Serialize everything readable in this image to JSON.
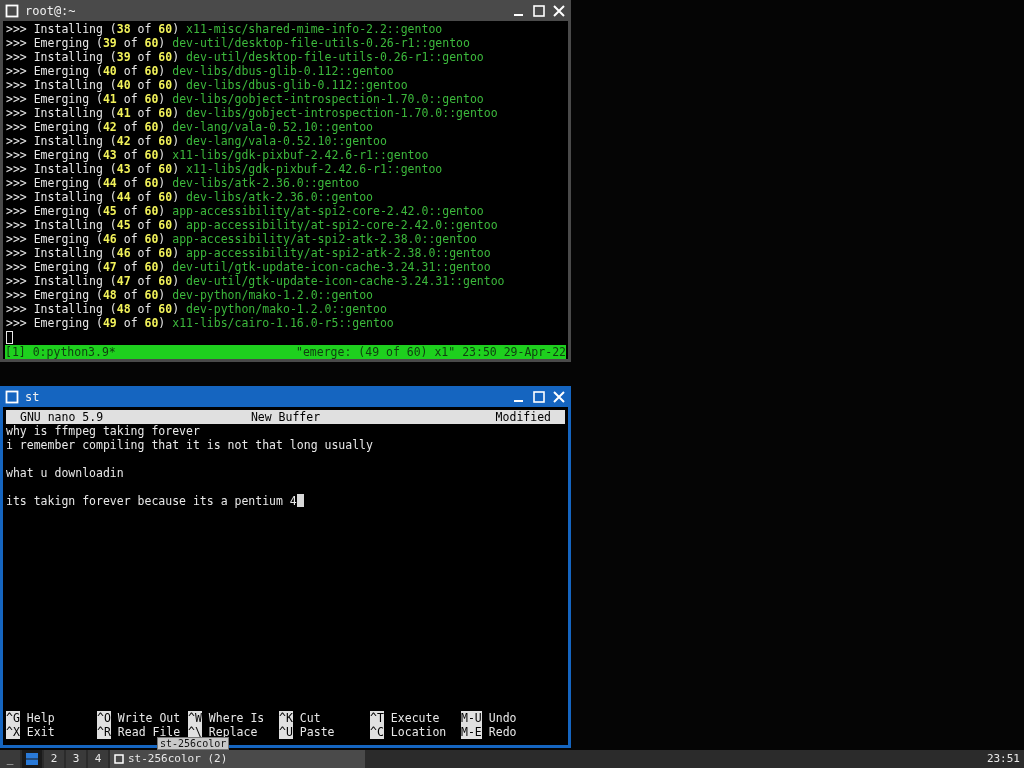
{
  "windows": [
    {
      "title": "root@:~",
      "focused": false,
      "kind": "tmux",
      "lines": [
        {
          "segments": [
            {
              "kind": "plain",
              "text": ">>> Installing ("
            },
            {
              "kind": "number",
              "text": "38"
            },
            {
              "kind": "plain",
              "text": " of "
            },
            {
              "kind": "number",
              "text": "60"
            },
            {
              "kind": "plain",
              "text": ") "
            },
            {
              "kind": "package",
              "text": "x11-misc/shared-mime-info-2.2::gentoo"
            }
          ]
        },
        {
          "segments": [
            {
              "kind": "plain",
              "text": ">>> Emerging ("
            },
            {
              "kind": "number",
              "text": "39"
            },
            {
              "kind": "plain",
              "text": " of "
            },
            {
              "kind": "number",
              "text": "60"
            },
            {
              "kind": "plain",
              "text": ") "
            },
            {
              "kind": "package",
              "text": "dev-util/desktop-file-utils-0.26-r1::gentoo"
            }
          ]
        },
        {
          "segments": [
            {
              "kind": "plain",
              "text": ">>> Installing ("
            },
            {
              "kind": "number",
              "text": "39"
            },
            {
              "kind": "plain",
              "text": " of "
            },
            {
              "kind": "number",
              "text": "60"
            },
            {
              "kind": "plain",
              "text": ") "
            },
            {
              "kind": "package",
              "text": "dev-util/desktop-file-utils-0.26-r1::gentoo"
            }
          ]
        },
        {
          "segments": [
            {
              "kind": "plain",
              "text": ">>> Emerging ("
            },
            {
              "kind": "number",
              "text": "40"
            },
            {
              "kind": "plain",
              "text": " of "
            },
            {
              "kind": "number",
              "text": "60"
            },
            {
              "kind": "plain",
              "text": ") "
            },
            {
              "kind": "package",
              "text": "dev-libs/dbus-glib-0.112::gentoo"
            }
          ]
        },
        {
          "segments": [
            {
              "kind": "plain",
              "text": ">>> Installing ("
            },
            {
              "kind": "number",
              "text": "40"
            },
            {
              "kind": "plain",
              "text": " of "
            },
            {
              "kind": "number",
              "text": "60"
            },
            {
              "kind": "plain",
              "text": ") "
            },
            {
              "kind": "package",
              "text": "dev-libs/dbus-glib-0.112::gentoo"
            }
          ]
        },
        {
          "segments": [
            {
              "kind": "plain",
              "text": ">>> Emerging ("
            },
            {
              "kind": "number",
              "text": "41"
            },
            {
              "kind": "plain",
              "text": " of "
            },
            {
              "kind": "number",
              "text": "60"
            },
            {
              "kind": "plain",
              "text": ") "
            },
            {
              "kind": "package",
              "text": "dev-libs/gobject-introspection-1.70.0::gentoo"
            }
          ]
        },
        {
          "segments": [
            {
              "kind": "plain",
              "text": ">>> Installing ("
            },
            {
              "kind": "number",
              "text": "41"
            },
            {
              "kind": "plain",
              "text": " of "
            },
            {
              "kind": "number",
              "text": "60"
            },
            {
              "kind": "plain",
              "text": ") "
            },
            {
              "kind": "package",
              "text": "dev-libs/gobject-introspection-1.70.0::gentoo"
            }
          ]
        },
        {
          "segments": [
            {
              "kind": "plain",
              "text": ">>> Emerging ("
            },
            {
              "kind": "number",
              "text": "42"
            },
            {
              "kind": "plain",
              "text": " of "
            },
            {
              "kind": "number",
              "text": "60"
            },
            {
              "kind": "plain",
              "text": ") "
            },
            {
              "kind": "package",
              "text": "dev-lang/vala-0.52.10::gentoo"
            }
          ]
        },
        {
          "segments": [
            {
              "kind": "plain",
              "text": ">>> Installing ("
            },
            {
              "kind": "number",
              "text": "42"
            },
            {
              "kind": "plain",
              "text": " of "
            },
            {
              "kind": "number",
              "text": "60"
            },
            {
              "kind": "plain",
              "text": ") "
            },
            {
              "kind": "package",
              "text": "dev-lang/vala-0.52.10::gentoo"
            }
          ]
        },
        {
          "segments": [
            {
              "kind": "plain",
              "text": ">>> Emerging ("
            },
            {
              "kind": "number",
              "text": "43"
            },
            {
              "kind": "plain",
              "text": " of "
            },
            {
              "kind": "number",
              "text": "60"
            },
            {
              "kind": "plain",
              "text": ") "
            },
            {
              "kind": "package",
              "text": "x11-libs/gdk-pixbuf-2.42.6-r1::gentoo"
            }
          ]
        },
        {
          "segments": [
            {
              "kind": "plain",
              "text": ">>> Installing ("
            },
            {
              "kind": "number",
              "text": "43"
            },
            {
              "kind": "plain",
              "text": " of "
            },
            {
              "kind": "number",
              "text": "60"
            },
            {
              "kind": "plain",
              "text": ") "
            },
            {
              "kind": "package",
              "text": "x11-libs/gdk-pixbuf-2.42.6-r1::gentoo"
            }
          ]
        },
        {
          "segments": [
            {
              "kind": "plain",
              "text": ">>> Emerging ("
            },
            {
              "kind": "number",
              "text": "44"
            },
            {
              "kind": "plain",
              "text": " of "
            },
            {
              "kind": "number",
              "text": "60"
            },
            {
              "kind": "plain",
              "text": ") "
            },
            {
              "kind": "package",
              "text": "dev-libs/atk-2.36.0::gentoo"
            }
          ]
        },
        {
          "segments": [
            {
              "kind": "plain",
              "text": ">>> Installing ("
            },
            {
              "kind": "number",
              "text": "44"
            },
            {
              "kind": "plain",
              "text": " of "
            },
            {
              "kind": "number",
              "text": "60"
            },
            {
              "kind": "plain",
              "text": ") "
            },
            {
              "kind": "package",
              "text": "dev-libs/atk-2.36.0::gentoo"
            }
          ]
        },
        {
          "segments": [
            {
              "kind": "plain",
              "text": ">>> Emerging ("
            },
            {
              "kind": "number",
              "text": "45"
            },
            {
              "kind": "plain",
              "text": " of "
            },
            {
              "kind": "number",
              "text": "60"
            },
            {
              "kind": "plain",
              "text": ") "
            },
            {
              "kind": "package",
              "text": "app-accessibility/at-spi2-core-2.42.0::gentoo"
            }
          ]
        },
        {
          "segments": [
            {
              "kind": "plain",
              "text": ">>> Installing ("
            },
            {
              "kind": "number",
              "text": "45"
            },
            {
              "kind": "plain",
              "text": " of "
            },
            {
              "kind": "number",
              "text": "60"
            },
            {
              "kind": "plain",
              "text": ") "
            },
            {
              "kind": "package",
              "text": "app-accessibility/at-spi2-core-2.42.0::gentoo"
            }
          ]
        },
        {
          "segments": [
            {
              "kind": "plain",
              "text": ">>> Emerging ("
            },
            {
              "kind": "number",
              "text": "46"
            },
            {
              "kind": "plain",
              "text": " of "
            },
            {
              "kind": "number",
              "text": "60"
            },
            {
              "kind": "plain",
              "text": ") "
            },
            {
              "kind": "package",
              "text": "app-accessibility/at-spi2-atk-2.38.0::gentoo"
            }
          ]
        },
        {
          "segments": [
            {
              "kind": "plain",
              "text": ">>> Installing ("
            },
            {
              "kind": "number",
              "text": "46"
            },
            {
              "kind": "plain",
              "text": " of "
            },
            {
              "kind": "number",
              "text": "60"
            },
            {
              "kind": "plain",
              "text": ") "
            },
            {
              "kind": "package",
              "text": "app-accessibility/at-spi2-atk-2.38.0::gentoo"
            }
          ]
        },
        {
          "segments": [
            {
              "kind": "plain",
              "text": ">>> Emerging ("
            },
            {
              "kind": "number",
              "text": "47"
            },
            {
              "kind": "plain",
              "text": " of "
            },
            {
              "kind": "number",
              "text": "60"
            },
            {
              "kind": "plain",
              "text": ") "
            },
            {
              "kind": "package",
              "text": "dev-util/gtk-update-icon-cache-3.24.31::gentoo"
            }
          ]
        },
        {
          "segments": [
            {
              "kind": "plain",
              "text": ">>> Installing ("
            },
            {
              "kind": "number",
              "text": "47"
            },
            {
              "kind": "plain",
              "text": " of "
            },
            {
              "kind": "number",
              "text": "60"
            },
            {
              "kind": "plain",
              "text": ") "
            },
            {
              "kind": "package",
              "text": "dev-util/gtk-update-icon-cache-3.24.31::gentoo"
            }
          ]
        },
        {
          "segments": [
            {
              "kind": "plain",
              "text": ">>> Emerging ("
            },
            {
              "kind": "number",
              "text": "48"
            },
            {
              "kind": "plain",
              "text": " of "
            },
            {
              "kind": "number",
              "text": "60"
            },
            {
              "kind": "plain",
              "text": ") "
            },
            {
              "kind": "package",
              "text": "dev-python/mako-1.2.0::gentoo"
            }
          ]
        },
        {
          "segments": [
            {
              "kind": "plain",
              "text": ">>> Installing ("
            },
            {
              "kind": "number",
              "text": "48"
            },
            {
              "kind": "plain",
              "text": " of "
            },
            {
              "kind": "number",
              "text": "60"
            },
            {
              "kind": "plain",
              "text": ") "
            },
            {
              "kind": "package",
              "text": "dev-python/mako-1.2.0::gentoo"
            }
          ]
        },
        {
          "segments": [
            {
              "kind": "plain",
              "text": ">>> Emerging ("
            },
            {
              "kind": "number",
              "text": "49"
            },
            {
              "kind": "plain",
              "text": " of "
            },
            {
              "kind": "number",
              "text": "60"
            },
            {
              "kind": "plain",
              "text": ") "
            },
            {
              "kind": "package",
              "text": "x11-libs/cairo-1.16.0-r5::gentoo"
            }
          ]
        }
      ],
      "cursor": true,
      "status_bar": {
        "left": "[1] 0:python3.9*",
        "right": "\"emerge: (49 of 60) x1\" 23:50 29-Apr-22"
      }
    },
    {
      "title": "st",
      "focused": true,
      "kind": "nano",
      "header": {
        "left": "GNU nano 5.9",
        "center": "New Buffer",
        "right": "Modified"
      },
      "lines": [
        {
          "kind": "text",
          "text": "why is ffmpeg taking forever"
        },
        {
          "kind": "text",
          "text": "i remember compiling that it is not that long usually"
        },
        {
          "kind": "blank"
        },
        {
          "kind": "text",
          "text": "what u downloadin"
        },
        {
          "kind": "blank"
        },
        {
          "kind": "text",
          "text": "its takign forever because its a pentium 4"
        }
      ],
      "cursor": true,
      "shortcuts": [
        [
          {
            "key": "^G",
            "label": "Help"
          },
          {
            "key": "^O",
            "label": "Write Out"
          },
          {
            "key": "^W",
            "label": "Where Is"
          },
          {
            "key": "^K",
            "label": "Cut"
          },
          {
            "key": "^T",
            "label": "Execute"
          },
          {
            "key": "M-U",
            "label": "Undo"
          }
        ],
        [
          {
            "key": "^X",
            "label": "Exit"
          },
          {
            "key": "^R",
            "label": "Read File"
          },
          {
            "key": "^\\",
            "label": "Replace"
          },
          {
            "key": "^U",
            "label": "Paste"
          },
          {
            "key": "^C",
            "label": "Location"
          },
          {
            "key": "M-E",
            "label": "Redo"
          }
        ]
      ]
    }
  ],
  "taskbar": {
    "show_desktop": "_",
    "workspaces": [
      {
        "kind": "icon",
        "selected": true
      },
      {
        "kind": "text",
        "label": "2",
        "selected": false
      },
      {
        "kind": "text",
        "label": "3",
        "selected": false
      },
      {
        "kind": "text",
        "label": "4",
        "selected": false
      }
    ],
    "tasks": [
      {
        "title": "st-256color (2)",
        "selected": true
      }
    ],
    "tooltip": "st-256color",
    "clock": "23:51"
  }
}
